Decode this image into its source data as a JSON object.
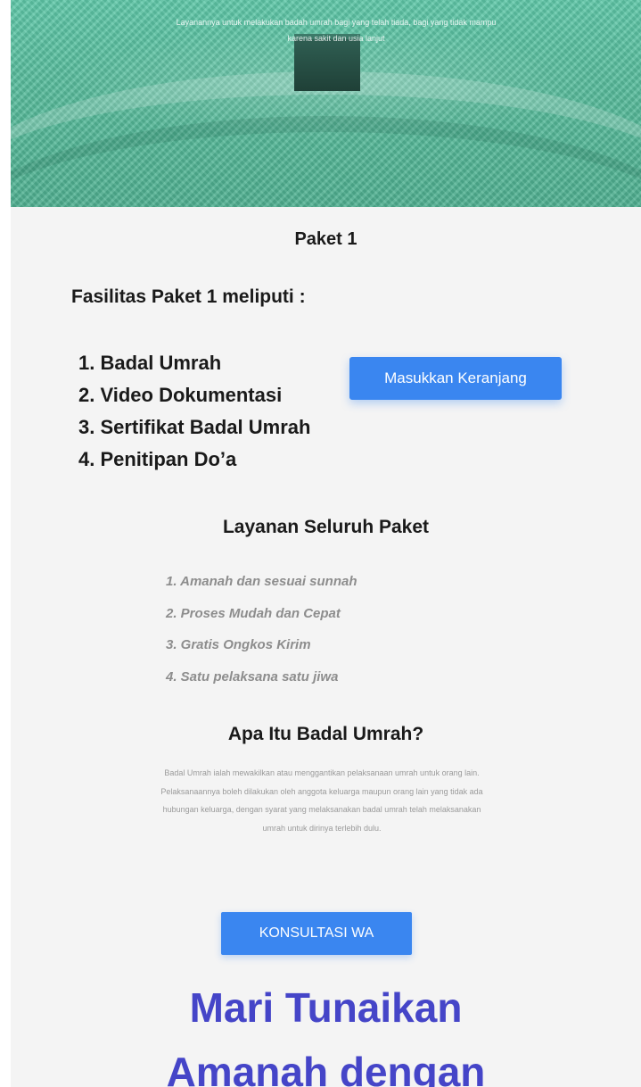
{
  "hero": {
    "line1": "Layanannya untuk melakukan badah umrah bagi yang telah tiada, bagi yang tidak mampu",
    "line2": "karena sakit dan usia lanjut"
  },
  "paket": {
    "title": "Paket 1",
    "fasilitas_heading": "Fasilitas Paket 1 meliputi :",
    "items": [
      "1. Badal Umrah",
      "2. Video Dokumentasi",
      "3. Sertifikat Badal Umrah",
      "4. Penitipan Do’a"
    ],
    "cart_button": "Masukkan Keranjang"
  },
  "layanan": {
    "title": "Layanan Seluruh Paket",
    "items": [
      "1. Amanah dan sesuai sunnah",
      "2. Proses Mudah dan Cepat",
      "3. Gratis Ongkos Kirim",
      "4. Satu pelaksana satu jiwa"
    ]
  },
  "apa_itu": {
    "title": "Apa Itu Badal Umrah?",
    "description": "Badal Umrah ialah mewakilkan atau menggantikan pelaksanaan umrah untuk orang lain. Pelaksanaannya boleh dilakukan oleh anggota keluarga maupun orang lain yang tidak ada hubungan keluarga, dengan syarat yang melaksanakan badal umrah telah melaksanakan umrah untuk dirinya terlebih dulu.",
    "wa_button": "KONSULTASI WA"
  },
  "cta": {
    "line1": "Mari Tunaikan",
    "line2": "Amanah dengan"
  },
  "colors": {
    "accent": "#3a86f0",
    "heading_purple": "#4545c8",
    "hero_tint": "#5fc9a9"
  }
}
